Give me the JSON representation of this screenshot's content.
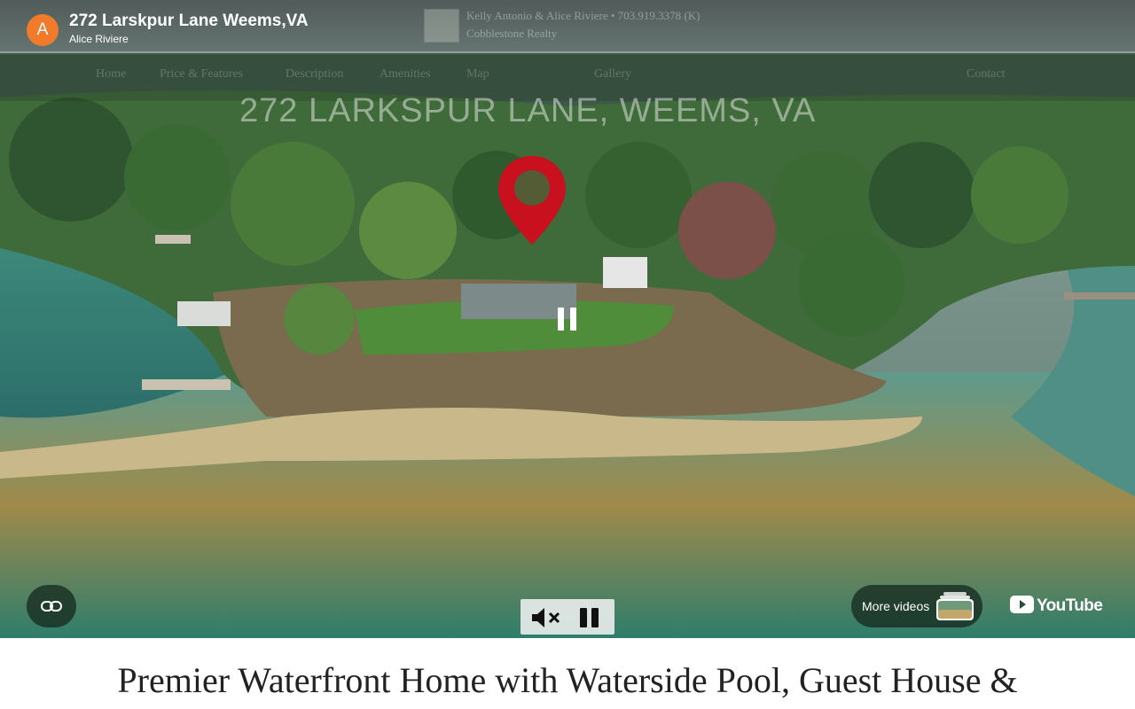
{
  "video": {
    "title": "272 Larskpur Lane Weems,VA",
    "channel": "Alice Riviere",
    "avatar_letter": "A",
    "avatar_color": "#f07b2a",
    "embedded_agent": {
      "line1": "Kelly Antonio & Alice Riviere • 703.919.3378 (K)",
      "line2": "Cobblestone Realty"
    },
    "embedded_nav": [
      "Home",
      "Price & Features",
      "Description",
      "Amenities",
      "Map",
      "Gallery",
      "Contact"
    ],
    "embedded_heading": "272 LARKSPUR LANE, WEEMS, VA",
    "more_videos_label": "More videos",
    "youtube_label": "YouTube"
  },
  "page": {
    "headline": "Premier Waterfront Home with Waterside Pool, Guest House &"
  },
  "colors": {
    "pin": "#c8101e",
    "accent": "#f07b2a"
  },
  "icons": [
    "link-icon",
    "mute-icon",
    "pause-icon",
    "map-pin-icon",
    "youtube-logo-icon"
  ]
}
